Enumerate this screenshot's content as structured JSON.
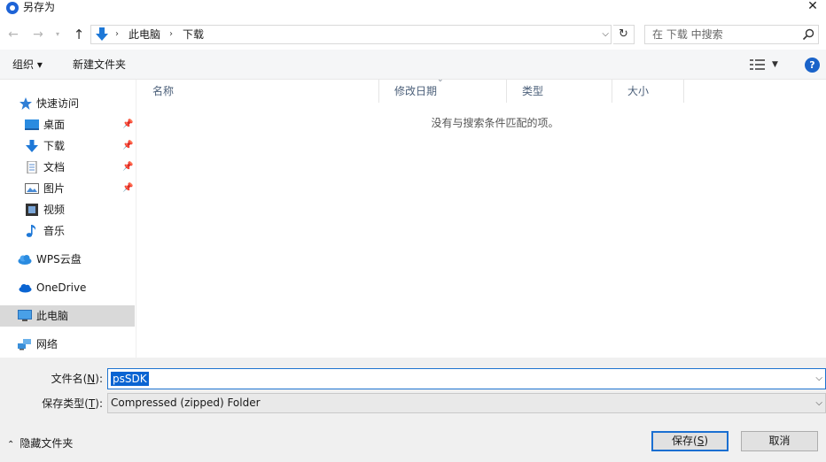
{
  "window": {
    "title": "另存为",
    "icon": "app-circle-icon",
    "close_glyph": "✕"
  },
  "nav": {
    "back_icon": "back-arrow-icon",
    "forward_icon": "forward-arrow-icon",
    "up_icon": "up-arrow-icon",
    "breadcrumb": [
      "此电脑",
      "下载"
    ],
    "search_placeholder": "在 下载 中搜索"
  },
  "toolbar": {
    "organize_label": "组织 ▾",
    "new_folder_label": "新建文件夹"
  },
  "sidebar": {
    "items": [
      {
        "label": "快速访问",
        "icon": "star-icon"
      },
      {
        "label": "桌面",
        "icon": "desktop-icon",
        "pinned": true
      },
      {
        "label": "下载",
        "icon": "download-icon",
        "pinned": true
      },
      {
        "label": "文档",
        "icon": "document-icon",
        "pinned": true
      },
      {
        "label": "图片",
        "icon": "picture-icon",
        "pinned": true
      },
      {
        "label": "视频",
        "icon": "video-icon"
      },
      {
        "label": "音乐",
        "icon": "music-icon"
      },
      {
        "label": "WPS云盘",
        "icon": "cloud-icon"
      },
      {
        "label": "OneDrive",
        "icon": "onedrive-icon"
      },
      {
        "label": "此电脑",
        "icon": "computer-icon",
        "selected": true
      },
      {
        "label": "网络",
        "icon": "network-icon"
      }
    ]
  },
  "content": {
    "columns": [
      "名称",
      "修改日期",
      "类型",
      "大小"
    ],
    "empty_message": "没有与搜索条件匹配的项。"
  },
  "form": {
    "filename_label": "文件名(",
    "filename_key": "N",
    "filename_suffix": "):",
    "filename_value": "psSDK",
    "filetype_label": "保存类型(",
    "filetype_key": "T",
    "filetype_suffix": "):",
    "filetype_value": "Compressed (zipped) Folder"
  },
  "footer": {
    "hide_folders_label": "隐藏文件夹",
    "save_label": "保存(",
    "save_key": "S",
    "save_suffix": ")",
    "cancel_label": "取消"
  },
  "colors": {
    "accent": "#1b6fd1",
    "selection": "#0a64d2",
    "sidebar_selected": "#d9d9d9"
  }
}
